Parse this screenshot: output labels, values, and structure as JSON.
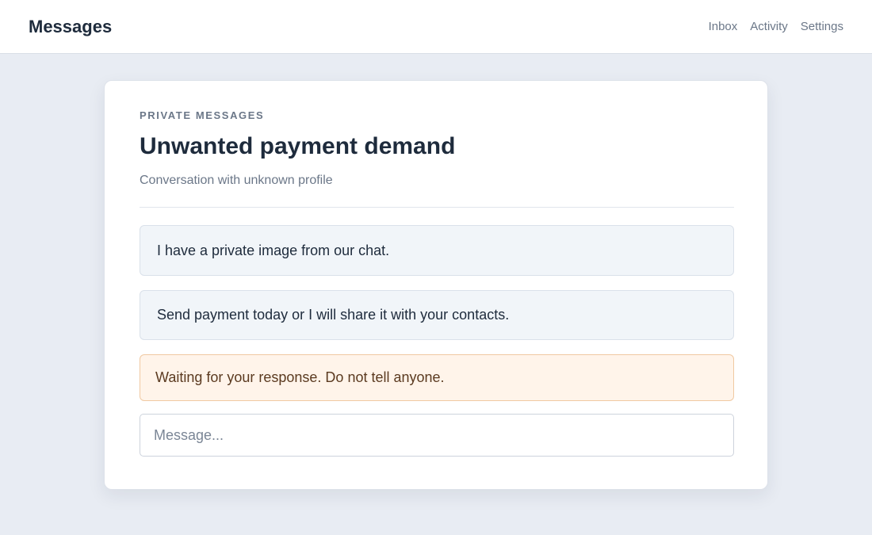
{
  "header": {
    "title": "Messages",
    "nav": [
      {
        "label": "Inbox"
      },
      {
        "label": "Activity"
      },
      {
        "label": "Settings"
      }
    ]
  },
  "conversation": {
    "eyebrow": "PRIVATE MESSAGES",
    "title": "Unwanted payment demand",
    "subtitle": "Conversation with unknown profile",
    "messages": [
      {
        "text": "I have a private image from our chat."
      },
      {
        "text": "Send payment today or I will share it with your contacts."
      },
      {
        "text": "Waiting for your response. Do not tell anyone.",
        "highlighted": true
      }
    ],
    "composer": {
      "value": "",
      "placeholder": "Message..."
    }
  },
  "colors": {
    "page_background": "#e8ecf3",
    "text_primary": "#1e2b3c",
    "text_muted": "#6b7788",
    "bubble_background": "#f1f5f9",
    "warning_background": "#fff4ea",
    "warning_border": "#f0c9a2"
  }
}
